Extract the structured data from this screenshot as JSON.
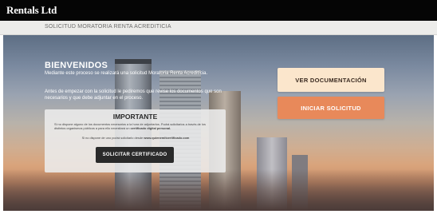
{
  "header": {
    "brand": "Rentals Ltd"
  },
  "subheader": {
    "title": "SOLICITUD MORATORIA RENTA ACREDITICIA"
  },
  "welcome": {
    "title": "BIENVENIDOS",
    "text1": "Mediante este proceso se realizará una solicitud Moratoria Renta Acreditícia.",
    "text2": "Antes de empezar con la solicitud le pediremos que revise los documentos que son necesarios y que debe adjuntar en el proceso."
  },
  "important": {
    "title": "IMPORTANTE",
    "text1": "Si no dispone alguno de los documentos necesarios a la hora de adjuntarlos. Podrá solicitarlos a través de los distintos organismos públicos a para ello necesitará un",
    "text1_bold": "certificado digital personal.",
    "text2": "Si no dispone de uno podrá solicitarlo desde",
    "text2_bold": "www.quienemitcertificado.com",
    "button": "SOLICITAR CERTIFICADO"
  },
  "actions": {
    "docs": "VER DOCUMENTACIÓN",
    "start": "INICIAR SOLICITUD"
  },
  "colors": {
    "header_bg": "#050505",
    "docs_button": "#fbe6cc",
    "start_button": "#e8895a",
    "important_button": "#2a2a2a"
  }
}
